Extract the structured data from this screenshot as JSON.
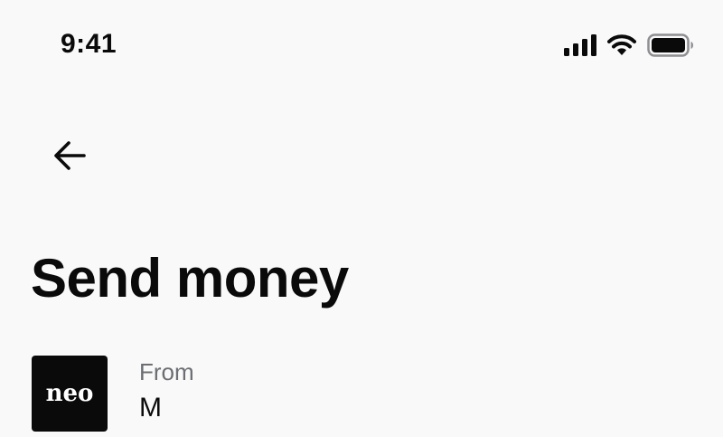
{
  "status_bar": {
    "time": "9:41",
    "icons": [
      "signal-icon",
      "wifi-icon",
      "battery-icon"
    ]
  },
  "navigation": {
    "back_icon": "arrow-left-icon"
  },
  "header": {
    "title": "Send money"
  },
  "from_account": {
    "logo_text": "neo",
    "label": "From",
    "name": "M"
  },
  "colors": {
    "background": "#f9f9f9",
    "text": "#0a0a0a",
    "secondary_text": "#6b6e72",
    "logo_bg": "#0a0a0a"
  }
}
